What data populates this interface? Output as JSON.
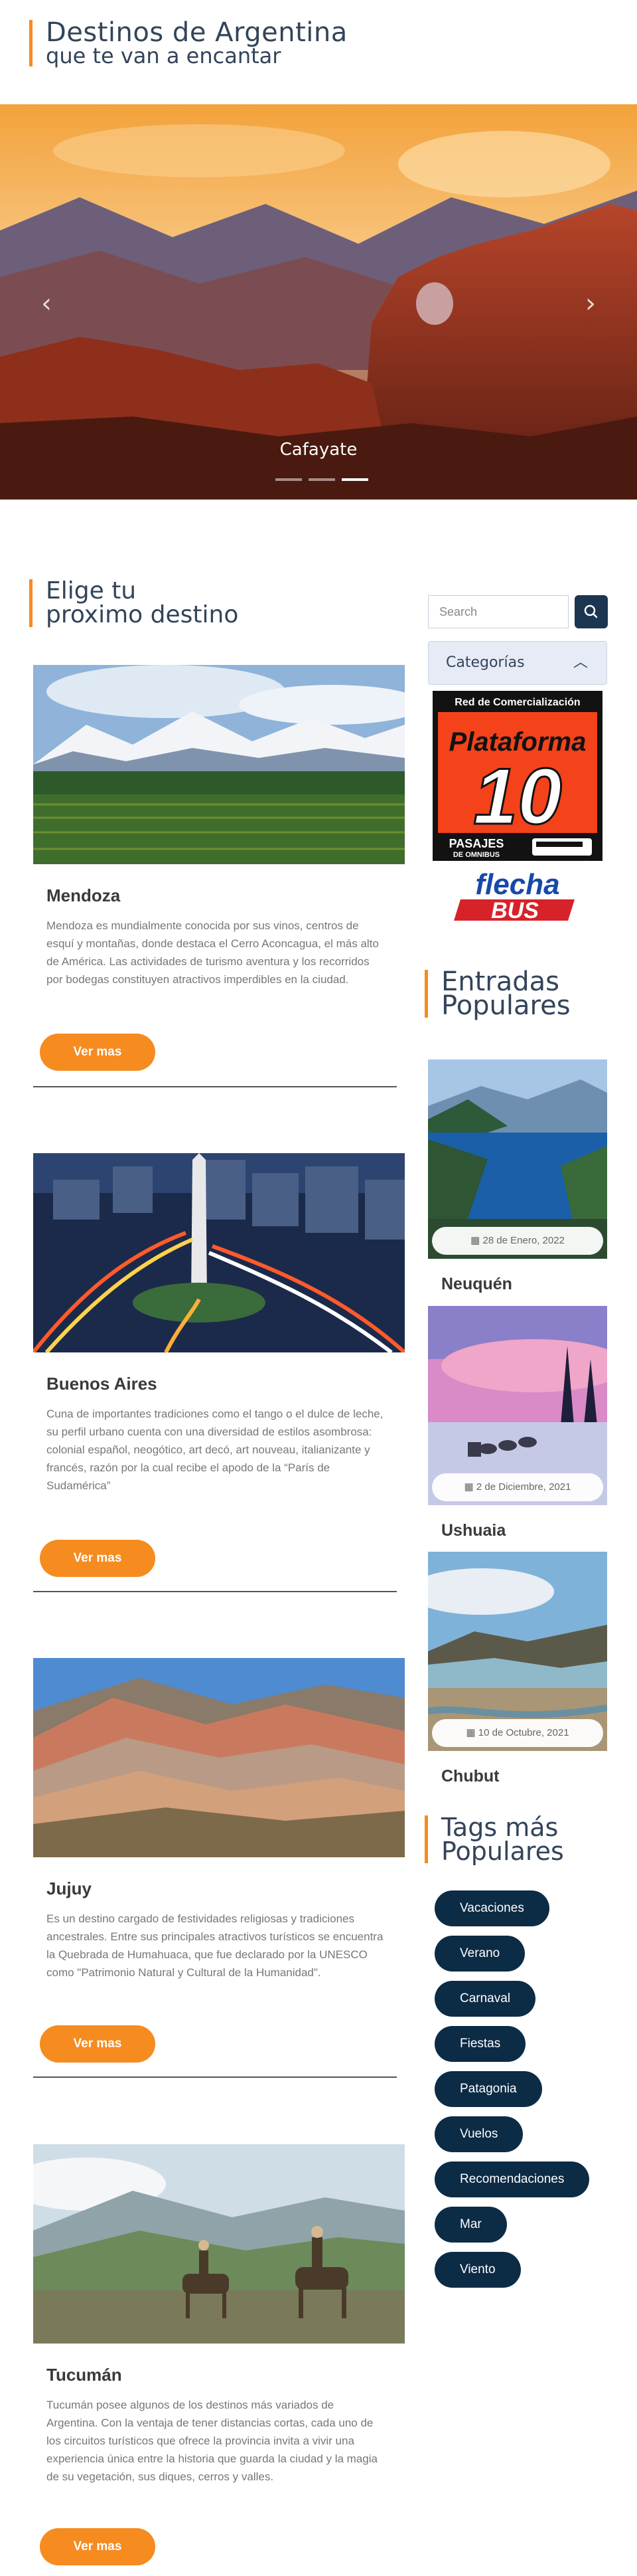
{
  "header": {
    "title_line1": "Destinos de Argentina",
    "title_line2": "que te van a encantar"
  },
  "hero": {
    "caption": "Cafayate",
    "prev_icon": "chevron-left-icon",
    "next_icon": "chevron-right-icon",
    "slide_count": 3,
    "active_slide": 2
  },
  "section": {
    "title_line1": "Elige tu",
    "title_line2": "proximo destino"
  },
  "destinations": [
    {
      "name": "Mendoza",
      "text": "Mendoza es mundialmente conocida por sus vinos, centros de esquí y montañas, donde destaca el Cerro Aconcagua, el más alto de América. Las actividades de turismo aventura y los recorridos por bodegas constituyen atractivos imperdibles en la ciudad.",
      "button": "Ver mas"
    },
    {
      "name": "Buenos Aires",
      "text": "Cuna de importantes tradiciones como el tango o el dulce de leche, su perfil urbano cuenta con una diversidad de estilos asombrosa: colonial español, neogótico, art decó, art nouveau, italianizante y francés, razón por la cual recibe el apodo de la “París de Sudamérica”",
      "button": "Ver mas"
    },
    {
      "name": "Jujuy",
      "text": "Es un destino cargado de festividades religiosas y tradiciones ancestrales. Entre sus principales atractivos turísticos se encuentra la Quebrada de Humahuaca, que fue declarado por la UNESCO como \"Patrimonio Natural y Cultural de la Humanidad\".",
      "button": "Ver mas"
    },
    {
      "name": "Tucumán",
      "text": "Tucumán posee algunos de los destinos más variados de Argentina. Con la ventaja de tener distancias cortas, cada uno de los circuitos turísticos que ofrece la provincia invita a vivir una experiencia única entre la historia que guarda la ciudad y la magia de su vegetación, sus diques, cerros y valles.",
      "button": "Ver mas"
    }
  ],
  "sidebar": {
    "search_placeholder": "Search",
    "categories_label": "Categorías",
    "logo1": {
      "line1": "Red de Comercialización",
      "line2": "Plataforma",
      "line3": "10",
      "line4": "PASAJES",
      "line5": "DE OMNIBUS"
    },
    "logo2": {
      "line1": "flecha",
      "line2": "BUS"
    },
    "popular_title_line1": "Entradas",
    "popular_title_line2": "Populares",
    "posts": [
      {
        "title": "Neuquén",
        "date": "28 de Enero, 2022"
      },
      {
        "title": "Ushuaia",
        "date": "2 de Diciembre, 2021"
      },
      {
        "title": "Chubut",
        "date": "10 de Octubre, 2021"
      }
    ],
    "tags_title_line1": "Tags más",
    "tags_title_line2": "Populares",
    "tags": [
      "Vacaciones",
      "Verano",
      "Carnaval",
      "Fiestas",
      "Patagonia",
      "Vuelos",
      "Recomendaciones",
      "Mar",
      "Viento"
    ]
  },
  "colors": {
    "accent": "#f68b1f",
    "navy": "#0c2b45",
    "heading": "#33445a"
  }
}
